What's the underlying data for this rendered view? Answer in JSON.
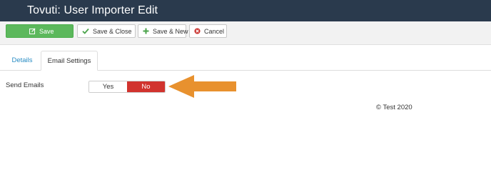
{
  "header": {
    "title": "Tovuti: User Importer Edit"
  },
  "toolbar": {
    "save_label": "Save",
    "save_close_label": "Save & Close",
    "save_new_label": "Save & New",
    "cancel_label": "Cancel"
  },
  "tabs": [
    {
      "label": "Details",
      "active": false
    },
    {
      "label": "Email Settings",
      "active": true
    }
  ],
  "form": {
    "send_emails": {
      "label": "Send Emails",
      "options": [
        "Yes",
        "No"
      ],
      "selected": "No"
    }
  },
  "footer": {
    "copyright": "© Test 2020"
  },
  "colors": {
    "header_bg": "#2a3a4d",
    "save_green": "#5cb85c",
    "no_red": "#d1332e",
    "arrow_orange": "#e8912e",
    "tab_link": "#2a8dc4"
  },
  "icons": {
    "save": "edit-icon",
    "save_close": "check-icon",
    "save_new": "plus-icon",
    "cancel": "cancel-circle-icon",
    "annotation": "arrow-left-icon"
  }
}
